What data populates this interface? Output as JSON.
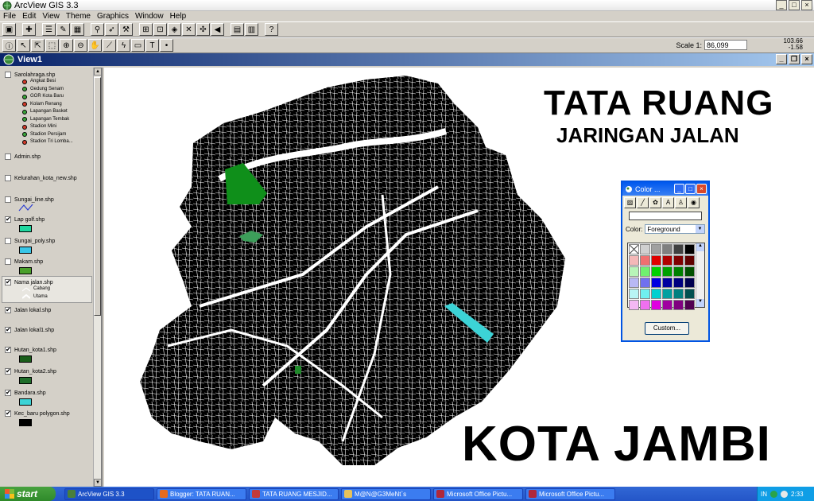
{
  "app": {
    "title": "ArcView GIS 3.3"
  },
  "menu": [
    "File",
    "Edit",
    "View",
    "Theme",
    "Graphics",
    "Window",
    "Help"
  ],
  "toolbar": {
    "scale_label": "Scale 1:",
    "scale_value": "86,099",
    "coord_x": "103.66",
    "coord_y": "-1.58"
  },
  "view": {
    "title": "View1"
  },
  "toc": {
    "themes": [
      {
        "name": "Sarolahraga.shp",
        "checked": false
      },
      {
        "name": "Admin.shp",
        "checked": false
      },
      {
        "name": "Kelurahan_kota_new.shp",
        "checked": false
      },
      {
        "name": "Sungai_line.shp",
        "checked": false
      },
      {
        "name": "Lap golf.shp",
        "checked": true,
        "color": "#1fd79f"
      },
      {
        "name": "Sungai_poly.shp",
        "checked": false,
        "color": "#38c6e8"
      },
      {
        "name": "Makam.shp",
        "checked": false,
        "color": "#4aa02a"
      },
      {
        "name": "Nama jalan.shp",
        "checked": true
      },
      {
        "name": "Jalan lokal.shp",
        "checked": true
      },
      {
        "name": "Jalan lokal1.shp",
        "checked": true
      },
      {
        "name": "Hutan_kota1.shp",
        "checked": true,
        "color": "#1a5e1a"
      },
      {
        "name": "Hutan_kota2.shp",
        "checked": true,
        "color": "#1f6e2a"
      },
      {
        "name": "Bandara.shp",
        "checked": true,
        "color": "#3cd3d6"
      },
      {
        "name": "Kec_baru polygon.shp",
        "checked": true,
        "color": "#000000"
      }
    ],
    "sarana_legend": [
      {
        "label": "Angkat Besi",
        "color": "#d13a2a"
      },
      {
        "label": "Gedung Senam",
        "color": "#3aa53a"
      },
      {
        "label": "GOR Kota Baru",
        "color": "#3aa53a"
      },
      {
        "label": "Kolam Renang",
        "color": "#d13a2a"
      },
      {
        "label": "Lapangan Basket",
        "color": "#3aa53a"
      },
      {
        "label": "Lapangan Tembak",
        "color": "#3aa53a"
      },
      {
        "label": "Stadion Mini",
        "color": "#d13a2a"
      },
      {
        "label": "Stadion Persijam",
        "color": "#3aa53a"
      },
      {
        "label": "Stadion Tri Lomba...",
        "color": "#d13a2a"
      }
    ],
    "jalan_legend": [
      "Cabang",
      "Utama"
    ]
  },
  "map": {
    "title1": "TATA RUANG",
    "title2": "JARINGAN JALAN",
    "title3": "KOTA JAMBI"
  },
  "palette": {
    "title": "Color ...",
    "color_label": "Color:",
    "selected": "Foreground",
    "custom_label": "Custom...",
    "colors": [
      "#ffffff",
      "#d0d0d0",
      "#a0a0a0",
      "#808080",
      "#404040",
      "#000000",
      "#f4b8b8",
      "#f07070",
      "#e00000",
      "#b00000",
      "#800000",
      "#600000",
      "#b8f4b8",
      "#70f070",
      "#00d000",
      "#00a000",
      "#008000",
      "#005000",
      "#b8b8f4",
      "#7070f0",
      "#0000e0",
      "#0000a0",
      "#000080",
      "#000050",
      "#b8f4f4",
      "#70f0f0",
      "#00d0d0",
      "#00a0a0",
      "#008080",
      "#005050",
      "#f4b8f4",
      "#f070f0",
      "#e000e0",
      "#a000a0",
      "#800080",
      "#500050"
    ]
  },
  "taskbar": {
    "start": "start",
    "tasks": [
      {
        "label": "ArcView GIS 3.3",
        "icon": "#4a7f3a"
      },
      {
        "label": "Blogger: TATA RUAN...",
        "icon": "#e86b1f"
      },
      {
        "label": "TATA RUANG MESJID...",
        "icon": "#c43a3a"
      },
      {
        "label": "M@N@G3MeNt`s",
        "icon": "#e8c25a"
      },
      {
        "label": "Microsoft Office Pictu...",
        "icon": "#b0283a"
      },
      {
        "label": "Microsoft Office Pictu...",
        "icon": "#b0283a"
      }
    ],
    "lang": "IN",
    "time": "2:33"
  }
}
